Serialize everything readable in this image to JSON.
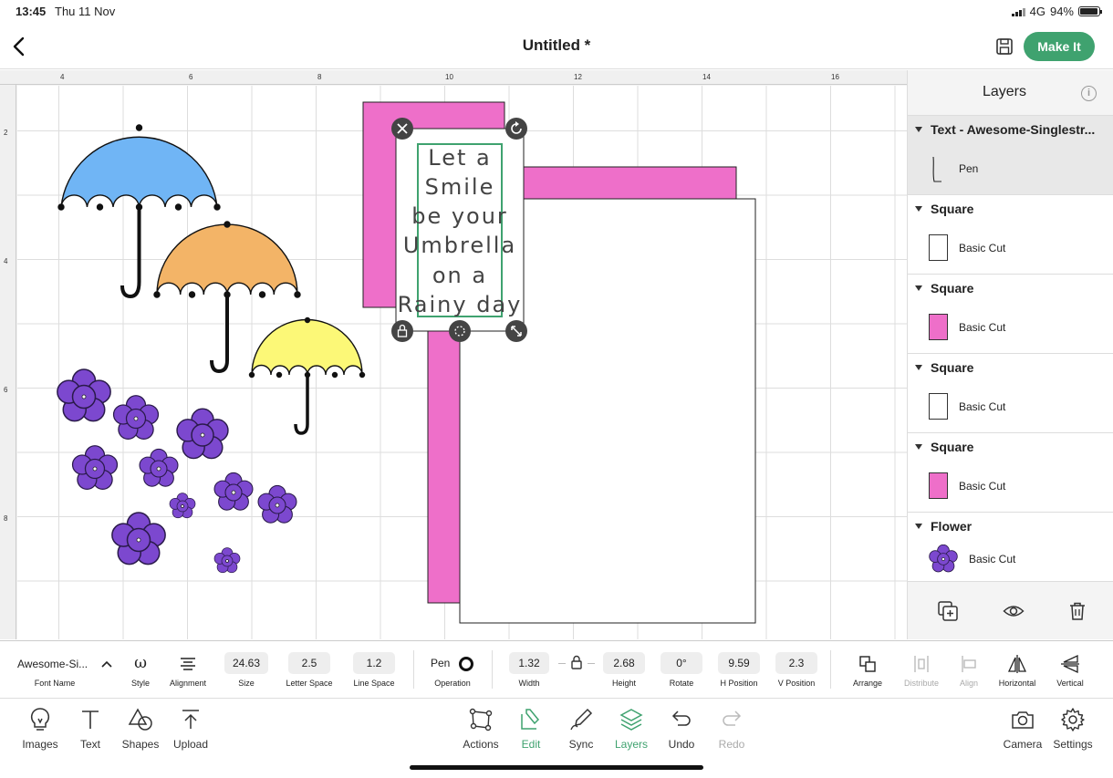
{
  "status_bar": {
    "time": "13:45",
    "date": "Thu 11 Nov",
    "network": "4G",
    "battery": "94%",
    "battery_level": 0.94
  },
  "header": {
    "title": "Untitled *",
    "make_it_label": "Make It"
  },
  "canvas": {
    "ruler_top_labels": [
      "4",
      "6",
      "8",
      "10",
      "12",
      "14",
      "16"
    ],
    "ruler_left_labels": [
      "2",
      "4",
      "6",
      "8"
    ],
    "text_block_lines": [
      "Let a",
      "Smile",
      "be your",
      "Umbrella",
      "on a",
      "Rainy day"
    ],
    "colors": {
      "pink": "#ee6fc9",
      "purple": "#7c48cf",
      "blue": "#70b5f5",
      "orange": "#f3b467",
      "yellow": "#fcf877",
      "accent": "#3fa26f"
    }
  },
  "layers_panel": {
    "title": "Layers",
    "groups": [
      {
        "title": "Text - Awesome-Singlestr...",
        "layer_label": "Pen",
        "swatch": "pen"
      },
      {
        "title": "Square",
        "layer_label": "Basic Cut",
        "swatch": "#ffffff"
      },
      {
        "title": "Square",
        "layer_label": "Basic Cut",
        "swatch": "#ee6fc9"
      },
      {
        "title": "Square",
        "layer_label": "Basic Cut",
        "swatch": "#ffffff"
      },
      {
        "title": "Square",
        "layer_label": "Basic Cut",
        "swatch": "#ee6fc9"
      },
      {
        "title": "Flower",
        "layer_label": "Basic Cut",
        "swatch": "flower"
      }
    ]
  },
  "edit_toolbar": {
    "font_name": "Awesome-Si...",
    "font_name_label": "Font Name",
    "style_label": "Style",
    "alignment_label": "Alignment",
    "size_value": "24.63",
    "size_label": "Size",
    "letter_space_value": "2.5",
    "letter_space_label": "Letter Space",
    "line_space_value": "1.2",
    "line_space_label": "Line Space",
    "operation_value": "Pen",
    "operation_label": "Operation",
    "width_value": "1.32",
    "width_label": "Width",
    "height_value": "2.68",
    "height_label": "Height",
    "rotate_value": "0°",
    "rotate_label": "Rotate",
    "hpos_value": "9.59",
    "hpos_label": "H Position",
    "vpos_value": "2.3",
    "vpos_label": "V Position",
    "arrange_label": "Arrange",
    "distribute_label": "Distribute",
    "align_label": "Align",
    "horizontal_label": "Horizontal",
    "vertical_label": "Vertical"
  },
  "bottom_nav": {
    "images": "Images",
    "text": "Text",
    "shapes": "Shapes",
    "upload": "Upload",
    "actions": "Actions",
    "edit": "Edit",
    "sync": "Sync",
    "layers": "Layers",
    "undo": "Undo",
    "redo": "Redo",
    "camera": "Camera",
    "settings": "Settings"
  }
}
